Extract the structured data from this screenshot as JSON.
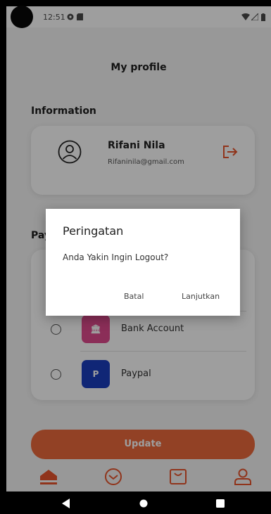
{
  "status_bar": {
    "time": "12:51"
  },
  "page_title": "My profile",
  "information": {
    "section_title": "Information",
    "user_name": "Rifani Nila",
    "user_email": "Rifaninila@gmail.com"
  },
  "payment": {
    "section_title_visible": "Pay",
    "methods": [
      {
        "label": "Bank Account",
        "logo_color": "#e04b8f",
        "icon": "bank-icon",
        "logo_glyph": "🏛"
      },
      {
        "label": "Paypal",
        "logo_color": "#1a3ebf",
        "icon": "paypal-icon",
        "logo_glyph": "P"
      }
    ]
  },
  "update_label": "Update",
  "nav": {
    "accent": "#ec6a3d",
    "items": [
      "home-icon",
      "explore-icon",
      "bag-icon",
      "profile-icon"
    ]
  },
  "dialog": {
    "title": "Peringatan",
    "message": "Anda Yakin Ingin Logout?",
    "cancel_label": "Batal",
    "confirm_label": "Lanjutkan"
  }
}
